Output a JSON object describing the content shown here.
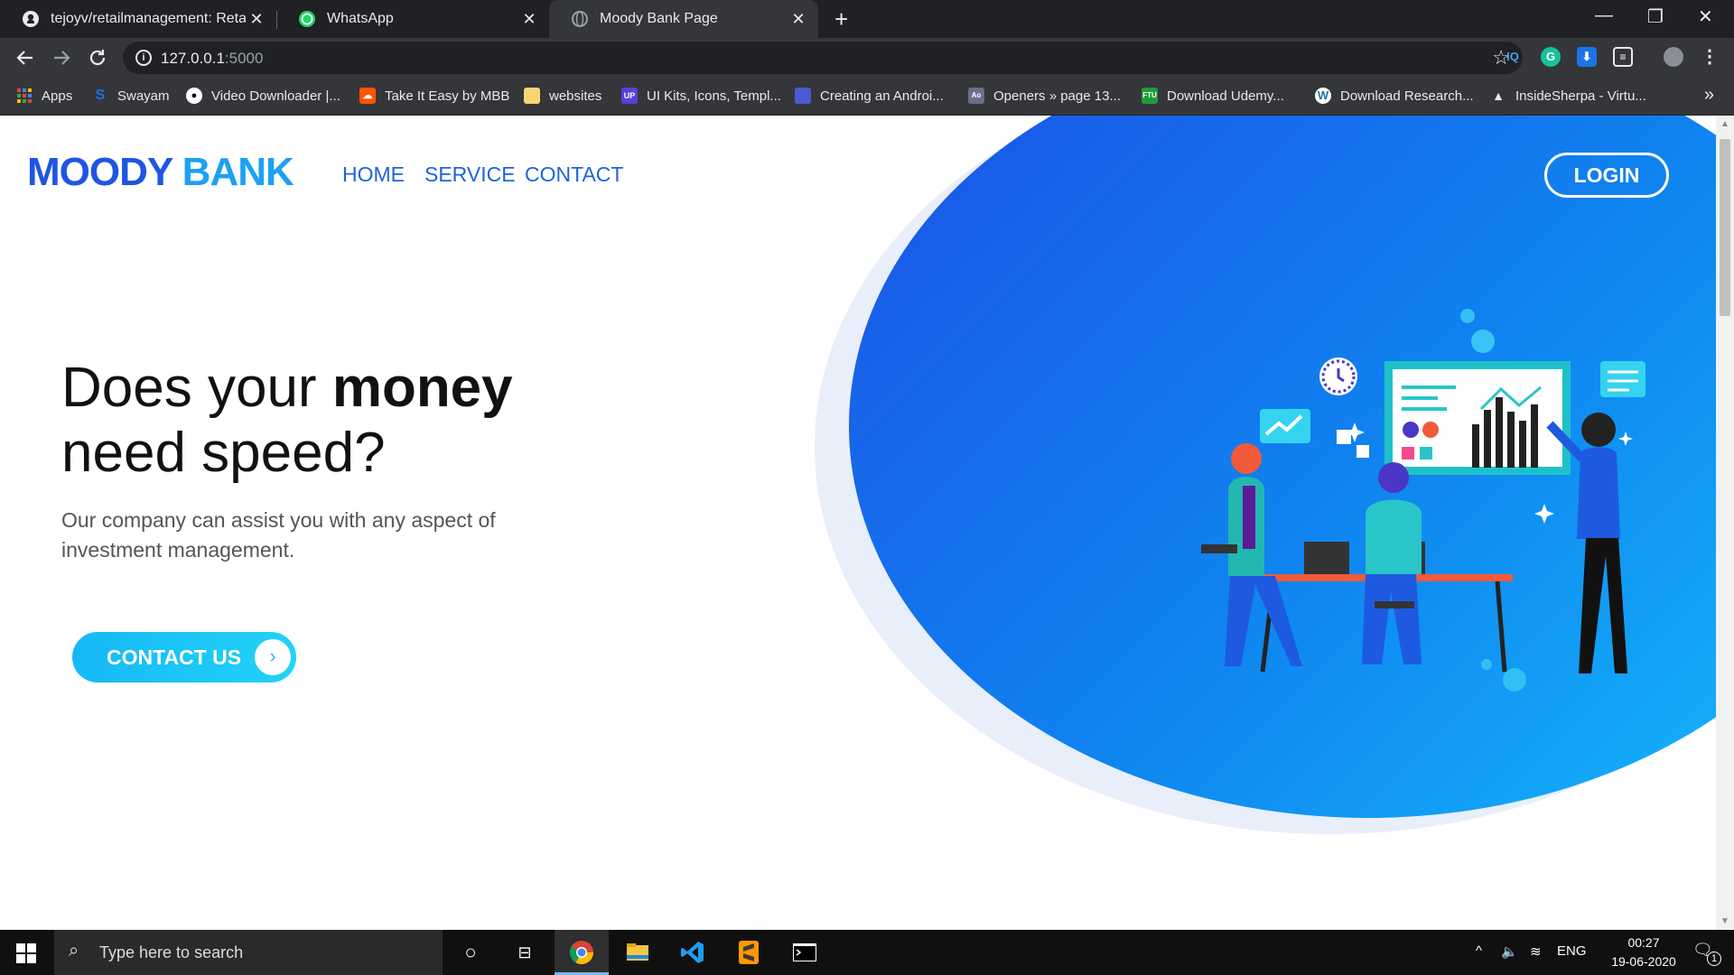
{
  "browser": {
    "tabs": [
      {
        "label": "tejoyv/retailmanagement: Retail I",
        "icon": "github-icon",
        "active": false
      },
      {
        "label": "WhatsApp",
        "icon": "whatsapp-icon",
        "active": false
      },
      {
        "label": "Moody Bank Page",
        "icon": "globe-icon",
        "active": true
      }
    ],
    "close_glyph": "✕",
    "new_tab_glyph": "+",
    "window_controls": [
      "—",
      "❐",
      "✕"
    ],
    "url_host": "127.0.0.1",
    "url_port": ":5000",
    "bookmarks": [
      "Apps",
      "Swayam",
      "Video Downloader |...",
      "Take It Easy by MBB",
      "websites",
      "UI Kits, Icons, Templ...",
      "Creating an Androi...",
      "Openers » page 13...",
      "Download Udemy...",
      "Download Research...",
      "InsideSherpa - Virtu..."
    ],
    "bookmark_more": "»",
    "extensions": [
      "IQ",
      "G",
      "⬇",
      "≡"
    ]
  },
  "site": {
    "brand_part1": "MOODY",
    "brand_part2": "BANK",
    "nav": [
      "HOME",
      "SERVICE",
      "CONTACT"
    ],
    "login_label": "LOGIN",
    "hero_title_pre": "Does your ",
    "hero_title_bold": "money",
    "hero_title_post": " need speed?",
    "hero_subtitle": "Our company can assist you with any aspect of investment management.",
    "cta_label": "CONTACT US",
    "cta_arrow": "›",
    "colors": {
      "brand_dark": "#1e55e4",
      "brand_light": "#1da0f4",
      "hero_gradient_start": "#1d4fe6",
      "hero_gradient_end": "#16bdfb",
      "cta": "#15b8f5"
    }
  },
  "taskbar": {
    "search_placeholder": "Type here to search",
    "language": "ENG",
    "time": "00:27",
    "date": "19-06-2020",
    "notification_count": "1",
    "apps": [
      "cortana-icon",
      "task-view-icon",
      "chrome-icon",
      "file-explorer-icon",
      "vscode-icon",
      "sublime-icon",
      "terminal-icon"
    ]
  }
}
